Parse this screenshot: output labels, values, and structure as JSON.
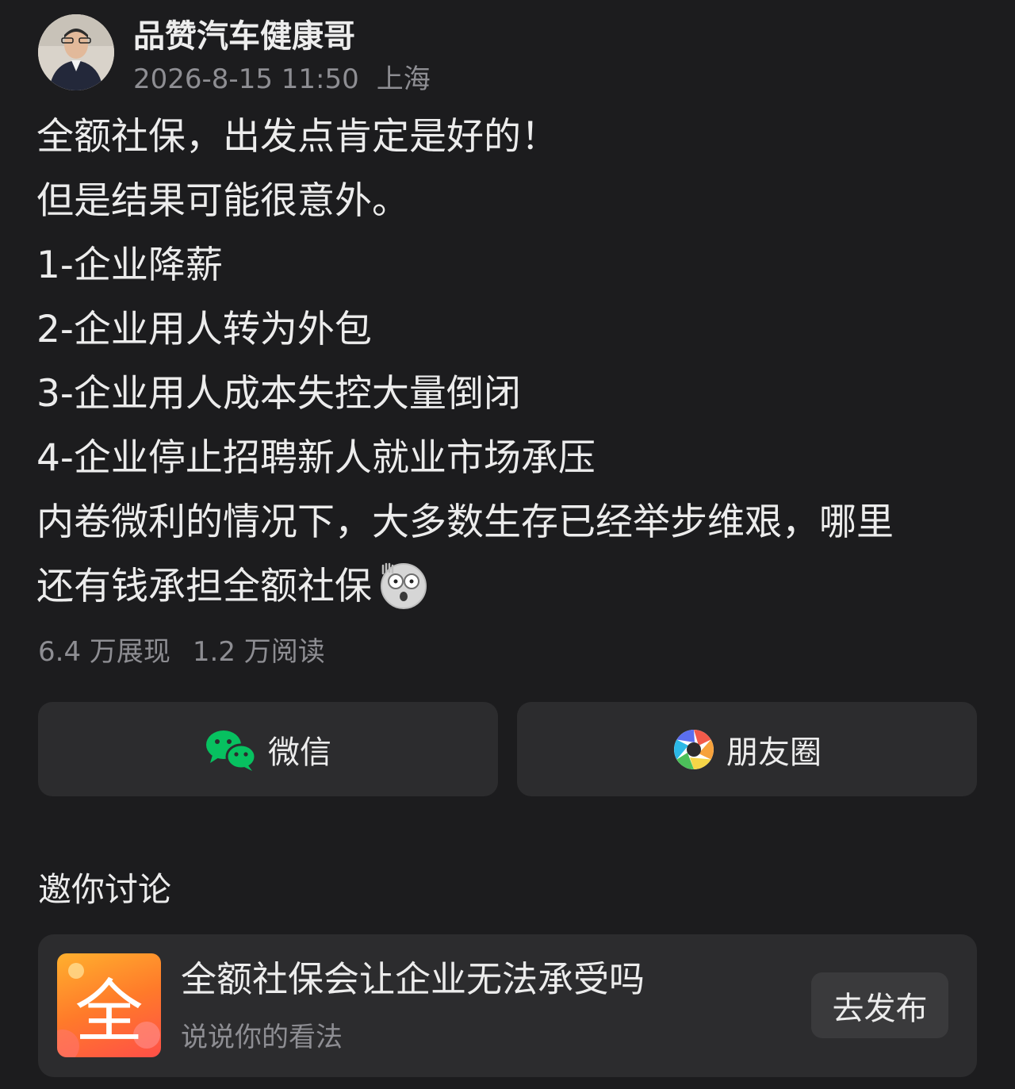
{
  "author": {
    "name": "品赞汽车健康哥",
    "date": "2026-8-15 11:50",
    "location": "上海",
    "avatar_icon": "avatar-photo"
  },
  "post": {
    "lines": [
      "全额社保，出发点肯定是好的！",
      "但是结果可能很意外。",
      "1-企业降薪",
      "2-企业用人转为外包",
      "3-企业用人成本失控大量倒闭",
      "4-企业停止招聘新人就业市场承压",
      "内卷微利的情况下，大多数生存已经举步维艰，哪里",
      "还有钱承担全额社保"
    ],
    "trailing_emoji": "shocked-face-icon"
  },
  "stats": {
    "impressions": "6.4 万展现",
    "reads": "1.2 万阅读"
  },
  "share": {
    "wechat_label": "微信",
    "moments_label": "朋友圈",
    "wechat_color": "#07c160"
  },
  "discussion": {
    "title": "邀你讨论",
    "topic_char": "全",
    "topic_title": "全额社保会让企业无法承受吗",
    "topic_sub": "说说你的看法",
    "publish_label": "去发布"
  }
}
